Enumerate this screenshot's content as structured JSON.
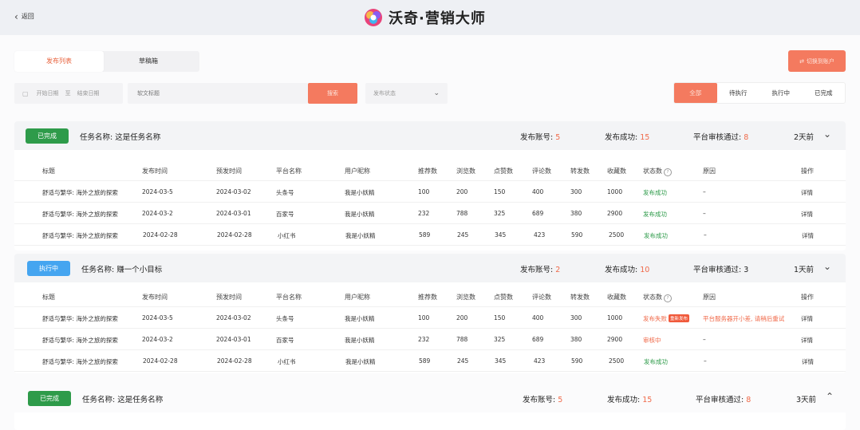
{
  "header": {
    "back_label": "返回",
    "brand": "沃奇·营销大师"
  },
  "tabs": [
    {
      "label": "发布列表",
      "active": true
    },
    {
      "label": "草稿箱",
      "active": false
    }
  ],
  "switch_button": "切换到账户",
  "filters": {
    "start_date": "开始日期",
    "to": "至",
    "end_date": "结束日期",
    "title_placeholder": "软文标题",
    "search": "搜索",
    "status_placeholder": "发布状态"
  },
  "segments": [
    {
      "label": "全部",
      "active": true
    },
    {
      "label": "待执行",
      "active": false
    },
    {
      "label": "执行中",
      "active": false
    },
    {
      "label": "已完成",
      "active": false
    }
  ],
  "columns": [
    "标题",
    "发布时间",
    "预发时间",
    "平台名称",
    "用户昵称",
    "推荐数",
    "浏览数",
    "点赞数",
    "评论数",
    "转发数",
    "收藏数",
    "状态数",
    "原因",
    "操作"
  ],
  "stat_labels": {
    "accounts": "发布账号:",
    "success": "发布成功:",
    "approved": "平台审核通过:"
  },
  "tasks": [
    {
      "status": "已完成",
      "status_type": "done",
      "name_label": "任务名称:",
      "name": "这是任务名称",
      "accounts": "5",
      "success": "15",
      "approved": "8",
      "ago": "2天前",
      "rows": [
        {
          "title": "舒适与繁华: 海外之旅的探索",
          "publish": "2024-03-5",
          "pre": "2024-03-02",
          "platform": "头条号",
          "nick": "我是小妖精",
          "rec": "100",
          "view": "200",
          "like": "150",
          "comment": "400",
          "share": "300",
          "fav": "1000",
          "state": "发布成功",
          "state_type": "green",
          "reason": "–",
          "op": "详情"
        },
        {
          "title": "舒适与繁华: 海外之旅的探索",
          "publish": "2024-03-2",
          "pre": "2024-03-01",
          "platform": "百家号",
          "nick": "我是小妖精",
          "rec": "232",
          "view": "788",
          "like": "325",
          "comment": "689",
          "share": "380",
          "fav": "2900",
          "state": "发布成功",
          "state_type": "green",
          "reason": "–",
          "op": "详情"
        },
        {
          "title": "舒适与繁华: 海外之旅的探索",
          "publish": "2024-02-28",
          "pre": "2024-02-28",
          "platform": "小红书",
          "nick": "我是小妖精",
          "rec": "589",
          "view": "245",
          "like": "345",
          "comment": "423",
          "share": "590",
          "fav": "2500",
          "state": "发布成功",
          "state_type": "green",
          "reason": "–",
          "op": "详情"
        }
      ]
    },
    {
      "status": "执行中",
      "status_type": "running",
      "name_label": "任务名称:",
      "name": "赚一个小目标",
      "accounts": "2",
      "success": "10",
      "approved": "3",
      "ago": "1天前",
      "rows": [
        {
          "title": "舒适与繁华: 海外之旅的探索",
          "publish": "2024-03-5",
          "pre": "2024-03-02",
          "platform": "头条号",
          "nick": "我是小妖精",
          "rec": "100",
          "view": "200",
          "like": "150",
          "comment": "400",
          "share": "300",
          "fav": "1000",
          "state": "发布失败",
          "state_type": "red",
          "tag": "重新发布",
          "reason": "平台服务器开小差, 请稍后重试",
          "op": "详情"
        },
        {
          "title": "舒适与繁华: 海外之旅的探索",
          "publish": "2024-03-2",
          "pre": "2024-03-01",
          "platform": "百家号",
          "nick": "我是小妖精",
          "rec": "232",
          "view": "788",
          "like": "325",
          "comment": "689",
          "share": "380",
          "fav": "2900",
          "state": "审核中",
          "state_type": "red",
          "reason": "–",
          "op": "详情"
        },
        {
          "title": "舒适与繁华: 海外之旅的探索",
          "publish": "2024-02-28",
          "pre": "2024-02-28",
          "platform": "小红书",
          "nick": "我是小妖精",
          "rec": "589",
          "view": "245",
          "like": "345",
          "comment": "423",
          "share": "590",
          "fav": "2500",
          "state": "发布成功",
          "state_type": "green",
          "reason": "–",
          "op": "详情"
        }
      ]
    },
    {
      "status": "已完成",
      "status_type": "done",
      "name_label": "任务名称:",
      "name": "这是任务名称",
      "accounts": "5",
      "success": "15",
      "approved": "8",
      "ago": "3天前",
      "rows": []
    }
  ],
  "colors": {
    "accent": "#f47a5f",
    "success": "#2e9b4a",
    "running": "#45a5f0",
    "danger": "#f06a4a"
  },
  "icons": {
    "back": "chevron-left-icon",
    "calendar": "calendar-icon",
    "select": "chevron-down-icon",
    "switch": "swap-icon",
    "info": "info-icon"
  }
}
